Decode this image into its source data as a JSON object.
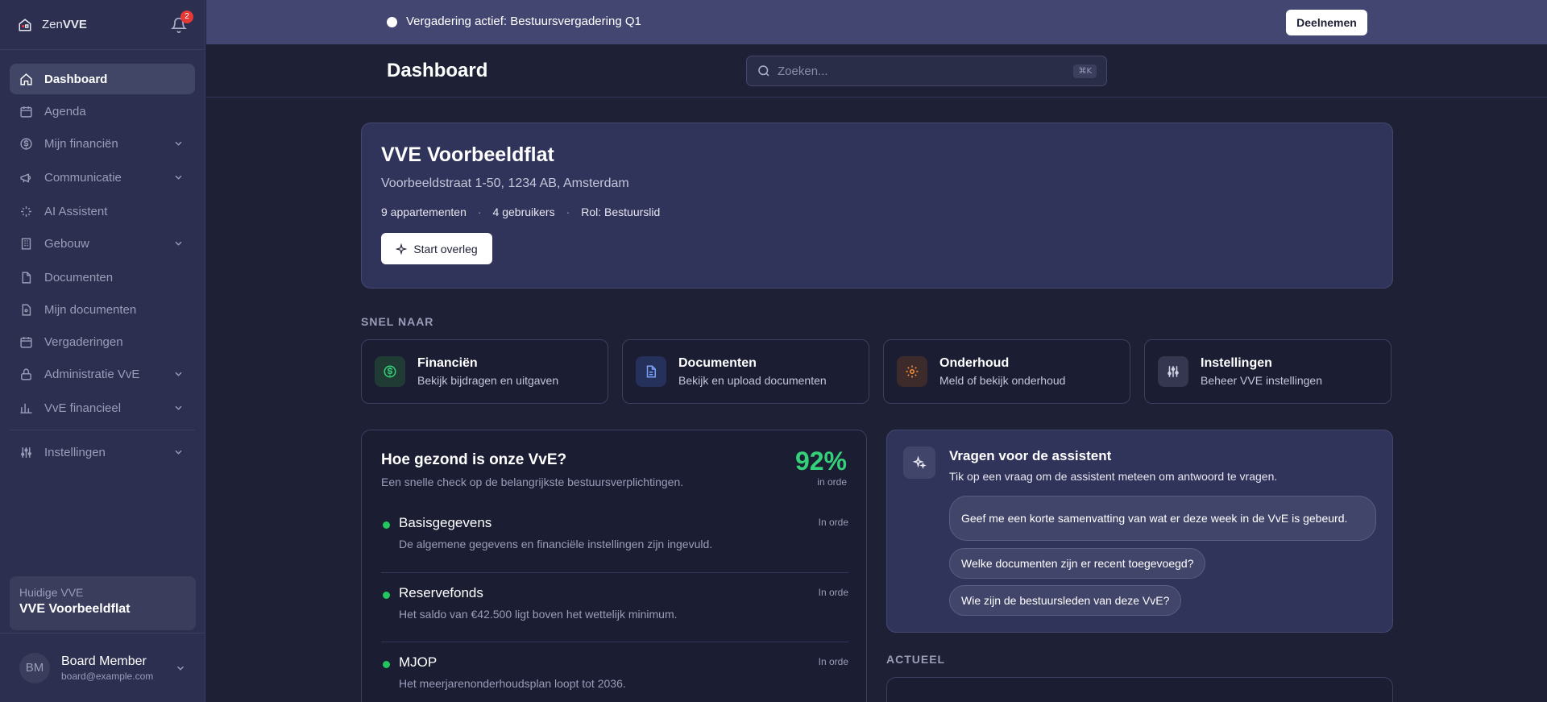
{
  "brand": {
    "prefix": "Zen",
    "suffix": "VVE",
    "notifications": "2"
  },
  "sidebar": {
    "items": [
      {
        "label": "Dashboard"
      },
      {
        "label": "Agenda"
      },
      {
        "label": "Mijn financiën"
      },
      {
        "label": "Communicatie"
      },
      {
        "label": "AI Assistent"
      },
      {
        "label": "Gebouw"
      },
      {
        "label": "Documenten"
      },
      {
        "label": "Mijn documenten"
      },
      {
        "label": "Vergaderingen"
      },
      {
        "label": "Administratie VvE"
      },
      {
        "label": "VvE financieel"
      },
      {
        "label": "Instellingen"
      }
    ],
    "current_vve": {
      "caption": "Huidige VVE",
      "name": "VVE Voorbeeldflat"
    },
    "user": {
      "initials": "BM",
      "name": "Board Member",
      "email": "board@example.com"
    }
  },
  "banner": {
    "text": "Vergadering actief: Bestuursvergadering Q1",
    "join_label": "Deelnemen"
  },
  "header": {
    "title": "Dashboard",
    "search_placeholder": "Zoeken...",
    "shortcut": "⌘K"
  },
  "hero": {
    "title": "VVE Voorbeeldflat",
    "address": "Voorbeeldstraat 1-50, 1234 AB, Amsterdam",
    "apartments": "9 appartementen",
    "users": "4 gebruikers",
    "role": "Rol: Bestuurslid",
    "start_label": "Start overleg"
  },
  "quick": {
    "label": "SNEL NAAR",
    "cards": [
      {
        "title": "Financiën",
        "subtitle": "Bekijk bijdragen en uitgaven"
      },
      {
        "title": "Documenten",
        "subtitle": "Bekijk en upload documenten"
      },
      {
        "title": "Onderhoud",
        "subtitle": "Meld of bekijk onderhoud"
      },
      {
        "title": "Instellingen",
        "subtitle": "Beheer VVE instellingen"
      }
    ]
  },
  "health": {
    "title": "Hoe gezond is onze VvE?",
    "subtitle": "Een snelle check op de belangrijkste bestuursverplichtingen.",
    "score": "92%",
    "score_label": "in orde",
    "rows": [
      {
        "title": "Basisgegevens",
        "desc": "De algemene gegevens en financiële instellingen zijn ingevuld.",
        "status": "In orde"
      },
      {
        "title": "Reservefonds",
        "desc": "Het saldo van €42.500 ligt boven het wettelijk minimum.",
        "status": "In orde"
      },
      {
        "title": "MJOP",
        "desc": "Het meerjarenonderhoudsplan loopt tot 2036.",
        "status": "In orde"
      }
    ]
  },
  "assistant": {
    "title": "Vragen voor de assistent",
    "subtitle": "Tik op een vraag om de assistent meteen om antwoord te vragen.",
    "questions": [
      "Geef me een korte samenvatting van wat er deze week in de VvE is gebeurd.",
      "Welke documenten zijn er recent toegevoegd?",
      "Wie zijn de bestuursleden van deze VvE?"
    ]
  },
  "actueel": {
    "label": "ACTUEEL"
  }
}
